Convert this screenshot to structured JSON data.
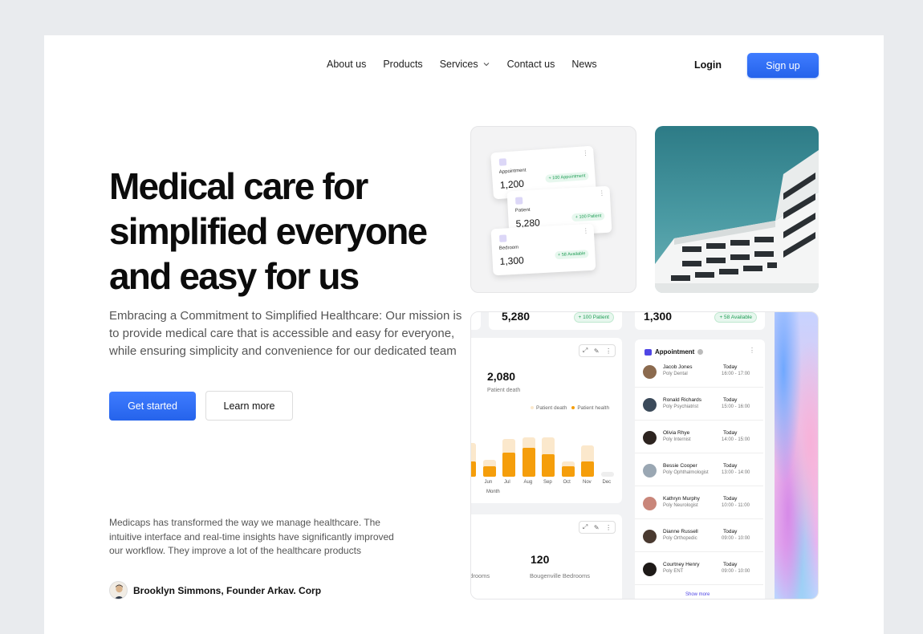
{
  "nav": {
    "items": [
      "About us",
      "Products",
      "Services",
      "Contact us",
      "News"
    ],
    "login": "Login",
    "signup": "Sign up"
  },
  "hero": {
    "title_line1": "Medical care for",
    "title_line2": "simplified everyone",
    "title_line3": "and easy for us",
    "description": "Embracing a Commitment to Simplified Healthcare: Our mission is to provide medical care that is accessible and easy for everyone, while ensuring simplicity and convenience for our dedicated team",
    "primary_cta": "Get started",
    "secondary_cta": "Learn more"
  },
  "testimonial": {
    "quote": "Medicaps has transformed the way we manage healthcare. The intuitive interface and real-time insights have significantly improved our workflow. They improve a lot of the healthcare products",
    "author": "Brooklyn Simmons, Founder Arkav. Corp"
  },
  "mini_cards": {
    "appointment": {
      "label": "Appointment",
      "value": "1,200",
      "tag": "+ 100 Appointment"
    },
    "patient": {
      "label": "Patient",
      "value": "5,280",
      "tag": "+ 100 Patient"
    },
    "bedroom": {
      "label": "Bedroom",
      "value": "1,300",
      "tag": "+ 58 Available"
    }
  },
  "dashboard": {
    "patient_total": "5,280",
    "patient_tag": "+ 100 Patient",
    "bedroom_total": "1,300",
    "bedroom_tag": "+ 58 Available",
    "death_value": "2,080",
    "death_label": "Patient death",
    "legend_death": "Patient death",
    "legend_health": "Patient health",
    "month_label": "Month",
    "bed_value": "120",
    "bed_label": "Bougenville Bedrooms",
    "bed_left_label": "edrooms",
    "appointment_title": "Appointment",
    "show_more": "Show more",
    "colors": {
      "health": "#fbe8cc",
      "death": "#f59e0b"
    }
  },
  "chart_data": {
    "type": "bar",
    "categories": [
      "",
      "Jun",
      "Jul",
      "Aug",
      "Sep",
      "Oct",
      "Nov",
      "Dec"
    ],
    "series": [
      {
        "name": "Patient health",
        "values": [
          40,
          20,
          44,
          46,
          46,
          18,
          37,
          6
        ]
      },
      {
        "name": "Patient death",
        "values": [
          18,
          12,
          28,
          34,
          26,
          12,
          18,
          0
        ]
      }
    ]
  },
  "appointments": [
    {
      "name": "Jacob Jones",
      "specialty": "Poly Dental",
      "day": "Today",
      "time": "16:00 - 17:00",
      "color": "#8b6a4e"
    },
    {
      "name": "Ronald Richards",
      "specialty": "Poly Psychiatrist",
      "day": "Today",
      "time": "15:00 - 16:00",
      "color": "#3b4a5a"
    },
    {
      "name": "Olivia Rhye",
      "specialty": "Poly Internist",
      "day": "Today",
      "time": "14:00 - 15:00",
      "color": "#2d2420"
    },
    {
      "name": "Bessie Cooper",
      "specialty": "Poly Ophthalmologist",
      "day": "Today",
      "time": "13:00 - 14:00",
      "color": "#9aa7b3"
    },
    {
      "name": "Kathryn Murphy",
      "specialty": "Poly Neurologist",
      "day": "Today",
      "time": "10:00 - 11:00",
      "color": "#c9867a"
    },
    {
      "name": "Dianne Russell",
      "specialty": "Poly Orthopedic",
      "day": "Today",
      "time": "09:00 - 10:00",
      "color": "#4a3a30"
    },
    {
      "name": "Courtney Henry",
      "specialty": "Poly ENT",
      "day": "Today",
      "time": "09:00 - 10:00",
      "color": "#1e1a18"
    }
  ]
}
